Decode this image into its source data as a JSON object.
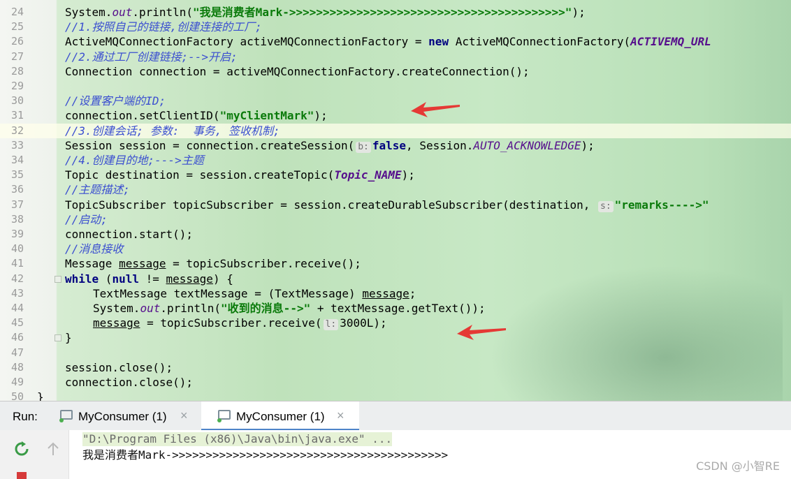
{
  "editor": {
    "lines": [
      {
        "num": "24",
        "tokens": [
          {
            "t": "System."
          },
          {
            "t": "out",
            "c": "stat"
          },
          {
            "t": ".println("
          },
          {
            "t": "\"我是消费者Mark->>>>>>>>>>>>>>>>>>>>>>>>>>>>>>>>>>>>>>>>>\"",
            "c": "str"
          },
          {
            "t": ");"
          }
        ]
      },
      {
        "num": "25",
        "tokens": [
          {
            "t": "//1.按照自己的链接,创建连接的工厂;",
            "c": "cmt"
          }
        ]
      },
      {
        "num": "26",
        "tokens": [
          {
            "t": "ActiveMQConnectionFactory activeMQConnectionFactory = "
          },
          {
            "t": "new",
            "c": "kw"
          },
          {
            "t": " ActiveMQConnectionFactory("
          },
          {
            "t": "ACTIVEMQ_URL",
            "c": "constf"
          }
        ]
      },
      {
        "num": "27",
        "tokens": [
          {
            "t": "//2.通过工厂创建链接;-->开启;",
            "c": "cmt"
          }
        ]
      },
      {
        "num": "28",
        "tokens": [
          {
            "t": "Connection connection = activeMQConnectionFactory.createConnection();"
          }
        ]
      },
      {
        "num": "29",
        "tokens": []
      },
      {
        "num": "30",
        "tokens": [
          {
            "t": "//设置客户端的ID;",
            "c": "cmt"
          }
        ]
      },
      {
        "num": "31",
        "tokens": [
          {
            "t": "connection.setClientID("
          },
          {
            "t": "\"myClientMark\"",
            "c": "str"
          },
          {
            "t": ");"
          }
        ]
      },
      {
        "num": "32",
        "current": true,
        "tokens": [
          {
            "t": "//3.创建会话; 参数:  事务, 签收机制;",
            "c": "cmt"
          }
        ]
      },
      {
        "num": "33",
        "tokens": [
          {
            "t": "Session session = connection.createSession("
          },
          {
            "t": "b:",
            "c": "hint"
          },
          {
            "t": "false",
            "c": "kw"
          },
          {
            "t": ", Session."
          },
          {
            "t": "AUTO_ACKNOWLEDGE",
            "c": "stat"
          },
          {
            "t": ");"
          }
        ]
      },
      {
        "num": "34",
        "tokens": [
          {
            "t": "//4.创建目的地;--->主题",
            "c": "cmt"
          }
        ]
      },
      {
        "num": "35",
        "tokens": [
          {
            "t": "Topic destination = session.createTopic("
          },
          {
            "t": "Topic_NAME",
            "c": "constf"
          },
          {
            "t": ");"
          }
        ]
      },
      {
        "num": "36",
        "tokens": [
          {
            "t": "//主题描述;",
            "c": "cmt"
          }
        ]
      },
      {
        "num": "37",
        "tokens": [
          {
            "t": "TopicSubscriber topicSubscriber = session.createDurableSubscriber(destination, "
          },
          {
            "t": "s:",
            "c": "hint"
          },
          {
            "t": "\"remarks---->\"",
            "c": "str"
          }
        ]
      },
      {
        "num": "38",
        "tokens": [
          {
            "t": "//启动;",
            "c": "cmt"
          }
        ]
      },
      {
        "num": "39",
        "tokens": [
          {
            "t": "connection.start();"
          }
        ]
      },
      {
        "num": "40",
        "tokens": [
          {
            "t": "//消息接收",
            "c": "cmt"
          }
        ]
      },
      {
        "num": "41",
        "tokens": [
          {
            "t": "Message "
          },
          {
            "t": "message",
            "c": "ul"
          },
          {
            "t": " = topicSubscriber.receive();"
          }
        ]
      },
      {
        "num": "42",
        "tokens": [
          {
            "t": "while",
            "c": "kw"
          },
          {
            "t": " ("
          },
          {
            "t": "null",
            "c": "kw"
          },
          {
            "t": " != "
          },
          {
            "t": "message",
            "c": "ul"
          },
          {
            "t": ") {"
          }
        ]
      },
      {
        "num": "43",
        "indent": 2,
        "tokens": [
          {
            "t": "TextMessage textMessage = (TextMessage) "
          },
          {
            "t": "message",
            "c": "ul"
          },
          {
            "t": ";"
          }
        ]
      },
      {
        "num": "44",
        "indent": 2,
        "tokens": [
          {
            "t": "System."
          },
          {
            "t": "out",
            "c": "stat"
          },
          {
            "t": ".println("
          },
          {
            "t": "\"收到的消息-->\"",
            "c": "str"
          },
          {
            "t": " + textMessage.getText());"
          }
        ]
      },
      {
        "num": "45",
        "indent": 2,
        "tokens": [
          {
            "t": "message",
            "c": "ul"
          },
          {
            "t": " = topicSubscriber.receive("
          },
          {
            "t": "l:",
            "c": "hint"
          },
          {
            "t": "3000L);"
          }
        ]
      },
      {
        "num": "46",
        "tokens": [
          {
            "t": "}"
          }
        ]
      },
      {
        "num": "47",
        "tokens": []
      },
      {
        "num": "48",
        "tokens": [
          {
            "t": "session.close();"
          }
        ]
      },
      {
        "num": "49",
        "tokens": [
          {
            "t": "connection.close();"
          }
        ]
      },
      {
        "num": "50",
        "outdent": true,
        "tokens": [
          {
            "t": "}"
          }
        ]
      }
    ]
  },
  "run": {
    "label": "Run:",
    "tabs": [
      {
        "label": "MyConsumer (1)",
        "active": false
      },
      {
        "label": "MyConsumer (1)",
        "active": true
      }
    ],
    "close_glyph": "×"
  },
  "console": {
    "command": "\"D:\\Program Files (x86)\\Java\\bin\\java.exe\" ...",
    "output": "我是消费者Mark->>>>>>>>>>>>>>>>>>>>>>>>>>>>>>>>>>>>>>>>>"
  },
  "watermark": "CSDN @小智RE",
  "colors": {
    "accent": "#4e84c9",
    "arrow": "#e53935",
    "run_green": "#4caf50",
    "stop_red": "#d63a3a"
  }
}
